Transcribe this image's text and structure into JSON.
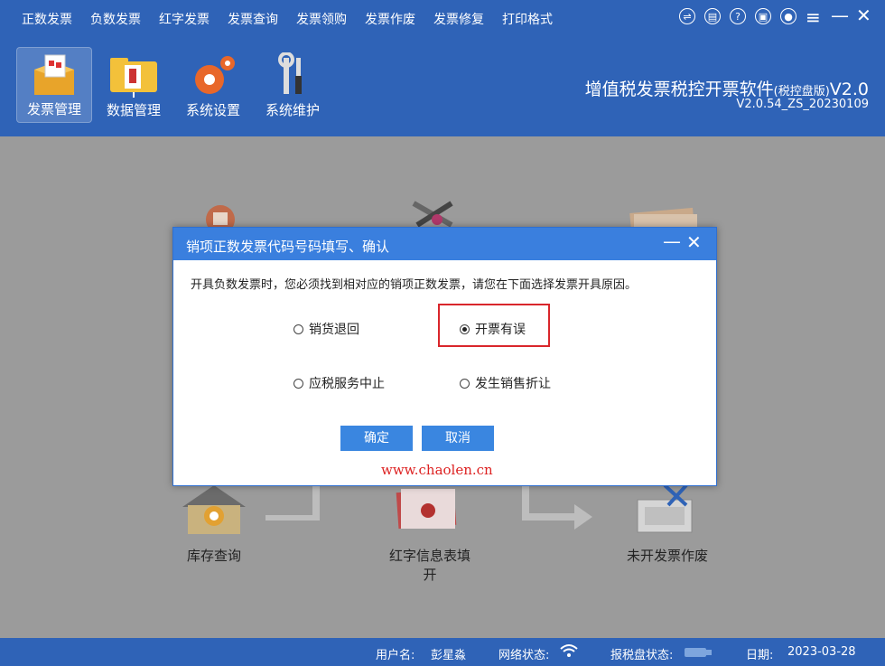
{
  "menu": [
    "正数发票",
    "负数发票",
    "红字发票",
    "发票查询",
    "发票领购",
    "发票作废",
    "发票修复",
    "打印格式"
  ],
  "window_icons": [
    "exchange-icon",
    "note-icon",
    "help-icon",
    "lock-icon",
    "user-icon",
    "menu-icon",
    "minimize-icon",
    "close-icon"
  ],
  "toolbar": [
    {
      "label": "发票管理",
      "icon": "invoice-box-icon",
      "active": true
    },
    {
      "label": "数据管理",
      "icon": "folder-icon",
      "active": false
    },
    {
      "label": "系统设置",
      "icon": "gears-icon",
      "active": false
    },
    {
      "label": "系统维护",
      "icon": "tools-icon",
      "active": false
    }
  ],
  "brand": {
    "title": "增值税发票税控开票软件",
    "edition": "(税控盘版)",
    "ver": "V2.0",
    "build": "V2.0.54_ZS_20230109"
  },
  "flow": {
    "items": [
      "库存查询",
      "红字信息表填开",
      "未开发票作废"
    ]
  },
  "dialog": {
    "title": "销项正数发票代码号码填写、确认",
    "message": "开具负数发票时，您必须找到相对应的销项正数发票，请您在下面选择发票开具原因。",
    "options": [
      {
        "label": "销货退回",
        "checked": false
      },
      {
        "label": "开票有误",
        "checked": true
      },
      {
        "label": "应税服务中止",
        "checked": false
      },
      {
        "label": "发生销售折让",
        "checked": false
      }
    ],
    "ok": "确定",
    "cancel": "取消",
    "watermark": "www.chaolen.cn"
  },
  "status": {
    "user_label": "用户名:",
    "user": "彭星淼",
    "net_label": "网络状态:",
    "disk_label": "报税盘状态:",
    "date_label": "日期:",
    "date": "2023-03-28"
  },
  "colors": {
    "primary": "#2f63b7",
    "dialog_header": "#3a7fde",
    "button": "#3a86e0",
    "highlight": "#d9262b"
  }
}
